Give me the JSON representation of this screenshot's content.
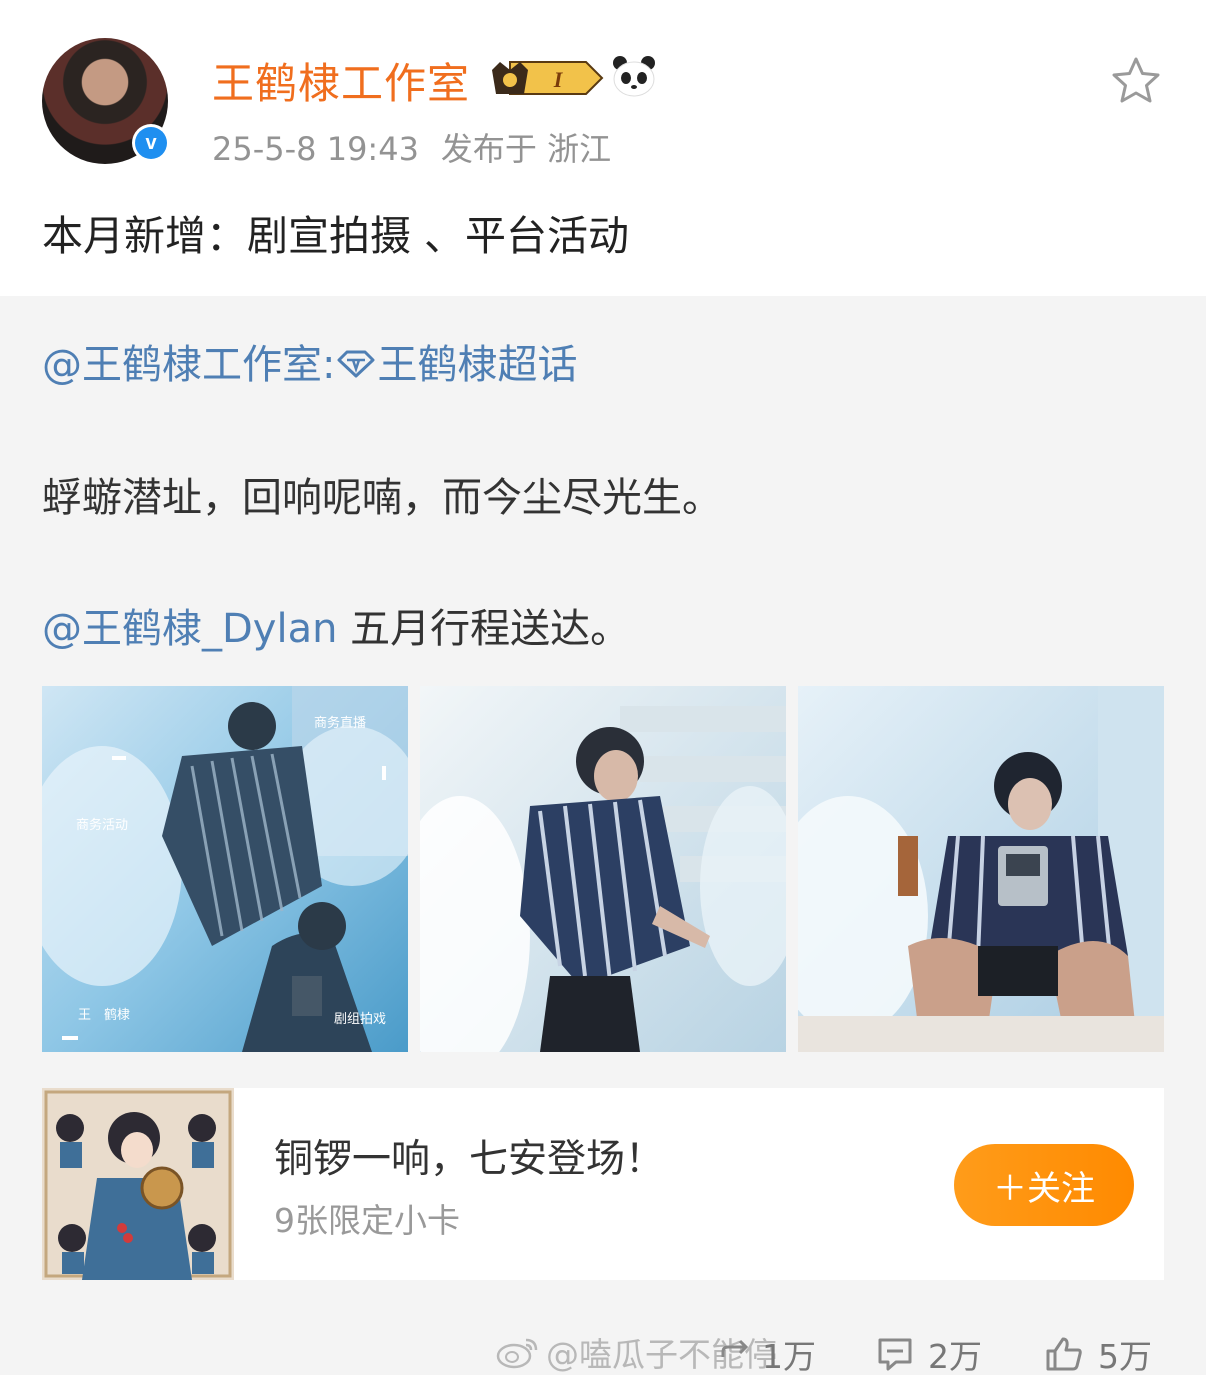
{
  "post": {
    "author": "王鹤棣工作室",
    "vip_level": "I",
    "time": "25-5-8 19:43",
    "location": "发布于 浙江",
    "text": "本月新增：剧宣拍摄 、平台活动"
  },
  "repost": {
    "author_mention": "@王鹤棣工作室:",
    "supertopic": "王鹤棣超话",
    "line1": "蜉蝣潜址，回响呢喃，而今尘尽光生。",
    "mention": "@王鹤棣_Dylan",
    "mention_suffix": " 五月行程送达。",
    "photo_labels": {
      "business_live": "商务直播",
      "business_activity": "商务活动",
      "name": "王　鹤棣",
      "crew_shoot": "剧组拍戏"
    }
  },
  "card": {
    "title": "铜锣一响，七安登场！",
    "subtitle": "9张限定小卡",
    "follow_label": "＋关注"
  },
  "footer": {
    "watermark": "@嗑瓜子不能停",
    "reposts": "1万",
    "comments": "2万",
    "likes": "5万"
  },
  "colors": {
    "username": "#f06e1e",
    "link": "#4f7fb4",
    "follow_button": "#ff9100",
    "repost_bg": "#f4f4f4"
  },
  "icons": [
    "crown-icon",
    "vip-badge-icon",
    "panda-icon",
    "star-icon",
    "verified-icon",
    "supertopic-diamond-icon",
    "weibo-logo-icon",
    "repost-icon",
    "comment-icon",
    "like-icon"
  ]
}
